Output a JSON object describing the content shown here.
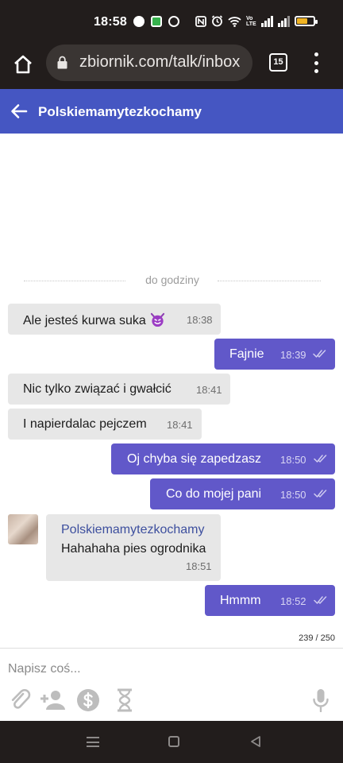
{
  "status_bar": {
    "time": "18:58"
  },
  "browser": {
    "url": "zbiornik.com/talk/inbox",
    "tab_count": "15"
  },
  "chat": {
    "title": "Polskiemamytezkochamy"
  },
  "separator": {
    "label": "do godziny"
  },
  "messages": [
    {
      "dir": "in",
      "text": "Ale jesteś kurwa suka",
      "emoji": "smiling-devil-emoji",
      "time": "18:38"
    },
    {
      "dir": "out",
      "text": "Fajnie",
      "time": "18:39"
    },
    {
      "dir": "in",
      "text": "Nic tylko związać i gwałcić",
      "time": "18:41"
    },
    {
      "dir": "in",
      "text": "I napierdalac pejczem",
      "time": "18:41"
    },
    {
      "dir": "out",
      "text": "Oj chyba się zapedzasz",
      "time": "18:50"
    },
    {
      "dir": "out",
      "text": "Co do mojej pani",
      "time": "18:50"
    },
    {
      "dir": "in",
      "sender": "Polskiemamytezkochamy",
      "text": "Hahahaha pies ogrodnika",
      "time": "18:51"
    },
    {
      "dir": "out",
      "text": "Hmmm",
      "time": "18:52"
    }
  ],
  "counter": "239 / 250",
  "compose": {
    "placeholder": "Napisz coś..."
  },
  "colors": {
    "header": "#4556c2",
    "outgoing": "#6158c9",
    "incoming": "#e7e7e7",
    "system_bar": "#221d1c"
  }
}
